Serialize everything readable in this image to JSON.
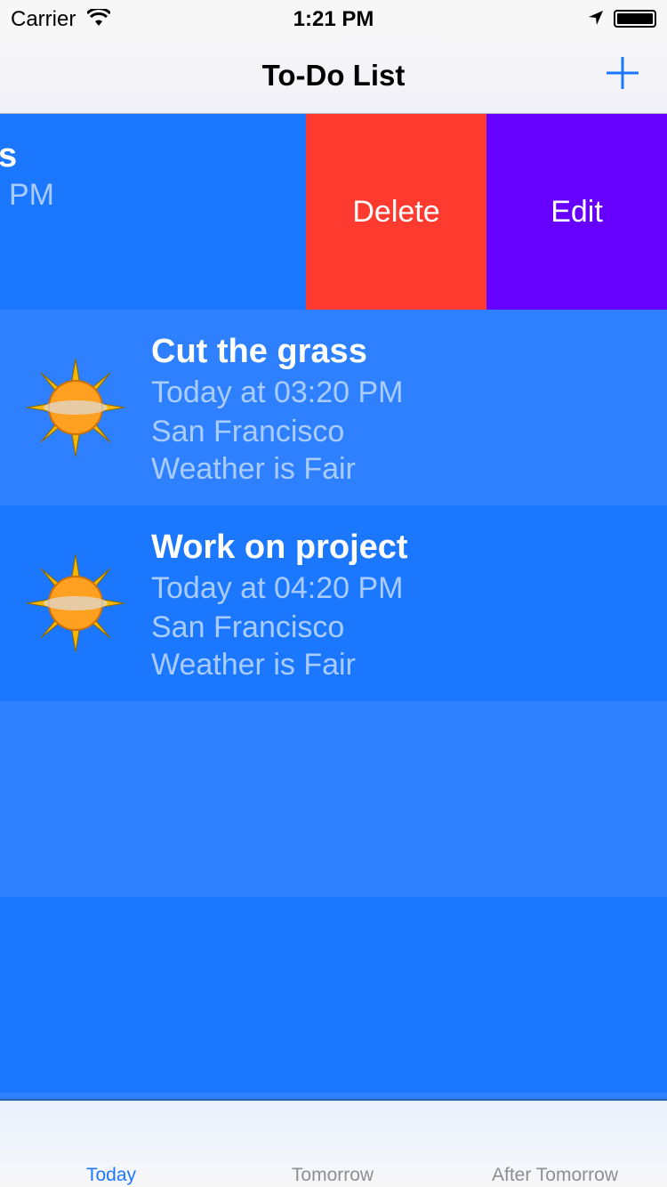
{
  "status_bar": {
    "carrier": "Carrier",
    "time": "1:21 PM"
  },
  "nav": {
    "title": "To-Do List",
    "add_icon": "plus-icon"
  },
  "swiped_row": {
    "title_fragment": "s",
    "time_fragment": "PM",
    "actions": {
      "delete": "Delete",
      "edit": "Edit"
    }
  },
  "todos": [
    {
      "title": "Cut the grass",
      "time": "Today at 03:20 PM",
      "location": "San Francisco",
      "weather": "Weather is Fair",
      "icon": "sun-icon"
    },
    {
      "title": "Work on project",
      "time": "Today at 04:20 PM",
      "location": "San Francisco",
      "weather": "Weather is Fair",
      "icon": "sun-icon"
    }
  ],
  "tabs": [
    {
      "label": "Today",
      "active": true
    },
    {
      "label": "Tomorrow"
    },
    {
      "label": "After Tomorrow"
    }
  ],
  "colors": {
    "accent": "#1c77ff",
    "delete": "#ff3b30",
    "edit": "#6600ff"
  }
}
